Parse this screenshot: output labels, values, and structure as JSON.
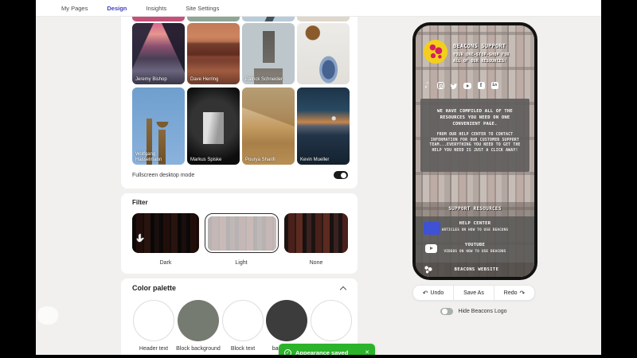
{
  "nav": {
    "items": [
      {
        "label": "My Pages",
        "active": false
      },
      {
        "label": "Design",
        "active": true
      },
      {
        "label": "Insights",
        "active": false
      },
      {
        "label": "Site Settings",
        "active": false
      }
    ],
    "active_color": "#4540bf"
  },
  "backgrounds_panel": {
    "items": [
      {
        "credit": "Jeremy Bishop",
        "image": "mountain-valley-sunset"
      },
      {
        "credit": "Dave Herring",
        "image": "desert-monument-valley"
      },
      {
        "credit": "Patrick Schneider",
        "image": "tall-tower-building"
      },
      {
        "credit": "",
        "image": "teacup-still-life"
      },
      {
        "credit": "Wolfgang Hasselmann",
        "image": "giraffes-blue-sky"
      },
      {
        "credit": "Markus Spiske",
        "image": "film-box-on-black"
      },
      {
        "credit": "Pourya Sharifi",
        "image": "sand-dune"
      },
      {
        "credit": "Kevin Mueller",
        "image": "mountain-lake-dusk"
      }
    ],
    "fullscreen_label": "Fullscreen desktop mode",
    "fullscreen_enabled": true
  },
  "filter_panel": {
    "title": "Filter",
    "options": [
      {
        "label": "Dark",
        "selected": false
      },
      {
        "label": "Light",
        "selected": true
      },
      {
        "label": "None",
        "selected": false
      }
    ]
  },
  "palette_panel": {
    "title": "Color palette",
    "swatches": [
      {
        "label": "Header text",
        "color": "#ffffff"
      },
      {
        "label": "Block background",
        "color": "#757b71"
      },
      {
        "label": "Block text",
        "color": "#ffffff"
      },
      {
        "label": "background",
        "color": "#3c3c3c"
      },
      {
        "label": "",
        "color": "#ffffff"
      }
    ]
  },
  "phone_preview": {
    "title": "BEACONS SUPPORT",
    "tagline_line1": "YOUR ONE-STOP-SHOP FOR",
    "tagline_line2": "ALL OF OUR RESOURCES!",
    "social_icons": [
      "tiktok",
      "instagram",
      "twitter",
      "youtube",
      "facebook",
      "linkedin"
    ],
    "intro_paragraph1": "WE HAVE COMPILED ALL OF THE RESOURCES YOU NEED ON ONE CONVENIENT PAGE.",
    "intro_paragraph2": "FROM OUR HELP CENTER TO CONTACT INFORMATION FOR OUR CUSTOMER SUPPORT TEAM...EVERYTHING YOU NEED TO GET THE HELP YOU NEED IS JUST A CLICK AWAY!",
    "section_heading": "SUPPORT RESOURCES",
    "links": [
      {
        "title": "HELP CENTER",
        "subtitle": "ARTICLES ON HOW TO USE BEACONS"
      },
      {
        "title": "YOUTUBE",
        "subtitle": "VIDEOS ON HOW TO USE BEACONS"
      }
    ],
    "footer_link": "BEACONS WEBSITE",
    "facebook_glyph": "f",
    "linkedin_glyph": "in",
    "tiktok_glyph": "♪"
  },
  "controls": {
    "undo": "Undo",
    "save_as": "Save As",
    "redo": "Redo",
    "undo_glyph": "↶",
    "redo_glyph": "↷",
    "hide_logo_label": "Hide Beacons Logo",
    "hide_logo_enabled": false
  },
  "toast": {
    "message": "Appearance saved",
    "check_glyph": "✓",
    "close_glyph": "✕",
    "color": "#2bb32b"
  }
}
